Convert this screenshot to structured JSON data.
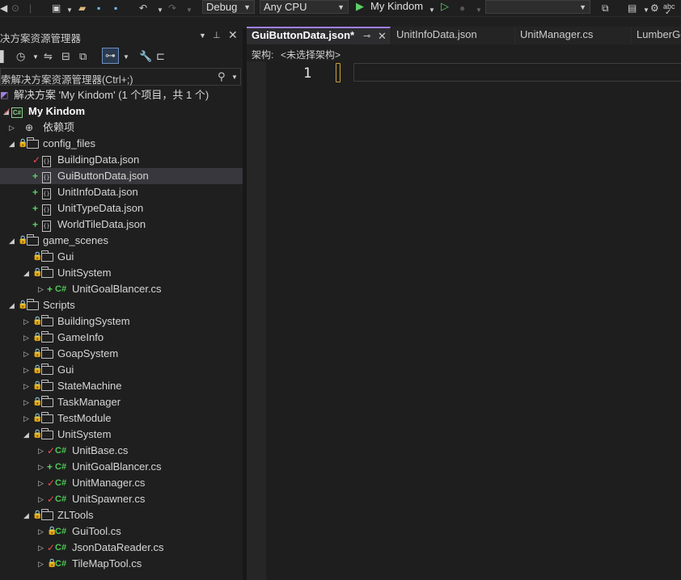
{
  "toolbar": {
    "config": "Debug",
    "platform": "Any CPU",
    "startup": "My Kindom",
    "spell": "abc"
  },
  "solution_explorer": {
    "title": "决方案资源管理器",
    "search_placeholder": "索解决方案资源管理器(Ctrl+;)"
  },
  "tree": {
    "solution": "解决方案 'My Kindom' (1 个项目，共 1 个)",
    "project": "My Kindom",
    "deps": "依赖项",
    "config_files": "config_files",
    "f_building": "BuildingData.json",
    "f_guibutton": "GuiButtonData.json",
    "f_unitinfo": "UnitInfoData.json",
    "f_unittype": "UnitTypeData.json",
    "f_worldtile": "WorldTileData.json",
    "game_scenes": "game_scenes",
    "gs_gui": "Gui",
    "gs_unitsystem": "UnitSystem",
    "gs_unitgoal": "UnitGoalBlancer.cs",
    "scripts": "Scripts",
    "s_building": "BuildingSystem",
    "s_gameinfo": "GameInfo",
    "s_goap": "GoapSystem",
    "s_gui": "Gui",
    "s_state": "StateMachine",
    "s_task": "TaskManager",
    "s_test": "TestModule",
    "s_unitsystem": "UnitSystem",
    "u_base": "UnitBase.cs",
    "u_goal": "UnitGoalBlancer.cs",
    "u_manager": "UnitManager.cs",
    "u_spawner": "UnitSpawner.cs",
    "zltools": "ZLTools",
    "z_gui": "GuiTool.cs",
    "z_json": "JsonDataReader.cs",
    "z_tile": "TileMapTool.cs"
  },
  "tabs": {
    "t1": "GuiButtonData.json*",
    "t2": "UnitInfoData.json",
    "t3": "UnitManager.cs",
    "t4": "LumberGo"
  },
  "schema": {
    "label": "架构:",
    "value": "<未选择架构>"
  },
  "editor": {
    "line_number": "1"
  }
}
